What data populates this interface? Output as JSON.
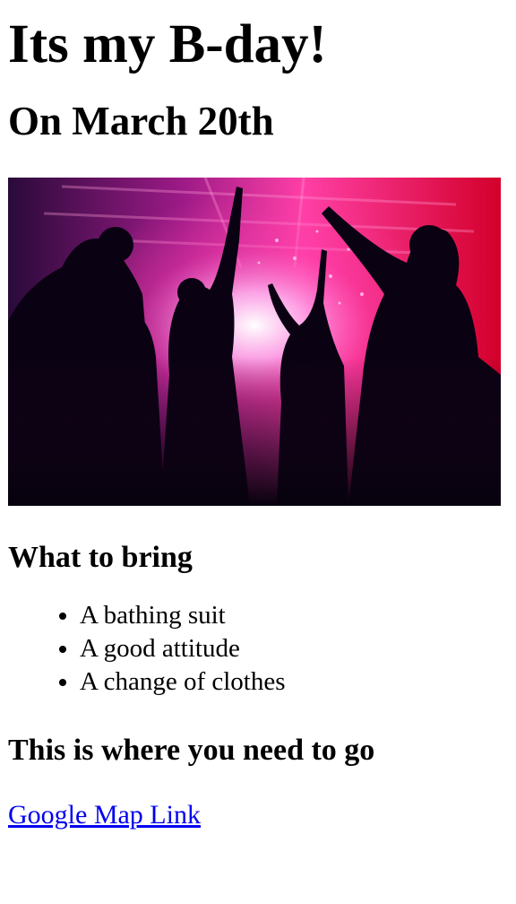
{
  "page": {
    "title": "Its my B-day!",
    "subtitle": "On March 20th"
  },
  "hero_image": {
    "description_icon": "party-crowd-image",
    "colors": {
      "magenta": "#c2187a",
      "pink_glow": "#ff7ad9",
      "red": "#e0102e",
      "dark": "#1a0420"
    }
  },
  "bring": {
    "heading": "What to bring",
    "items": [
      {
        "label": "A bathing suit"
      },
      {
        "label": "A good attitude"
      },
      {
        "label": "A change of clothes"
      }
    ]
  },
  "directions": {
    "heading": "This is where you need to go",
    "link_label": "Google Map Link",
    "link_color": "#0000ee"
  }
}
